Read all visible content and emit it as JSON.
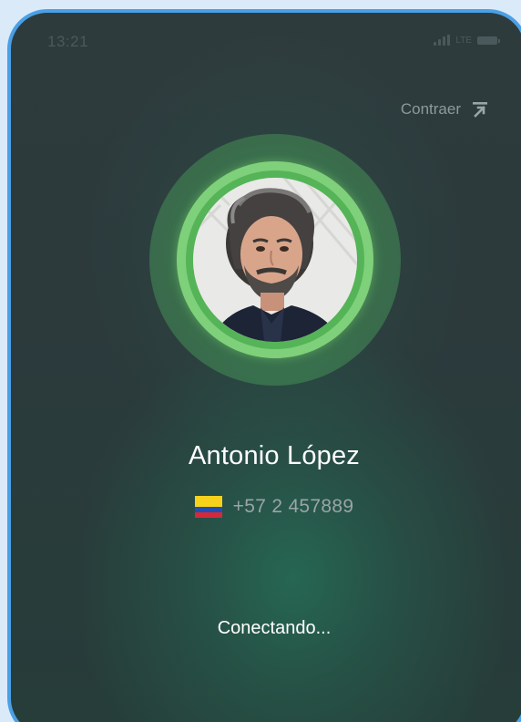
{
  "status_bar": {
    "time": "13:21",
    "network": "LTE"
  },
  "header": {
    "collapse_label": "Contraer",
    "collapse_icon": "arrow-up-to-line-icon"
  },
  "contact": {
    "name": "Antonio López",
    "phone": "+57 2 457889",
    "country_flag": "colombia-flag-icon"
  },
  "call": {
    "status": "Conectando..."
  },
  "colors": {
    "frame_border": "#4aa0e6",
    "ring_green": "#55b457",
    "text_primary": "#ffffff",
    "text_secondary": "#9aa5a5"
  }
}
